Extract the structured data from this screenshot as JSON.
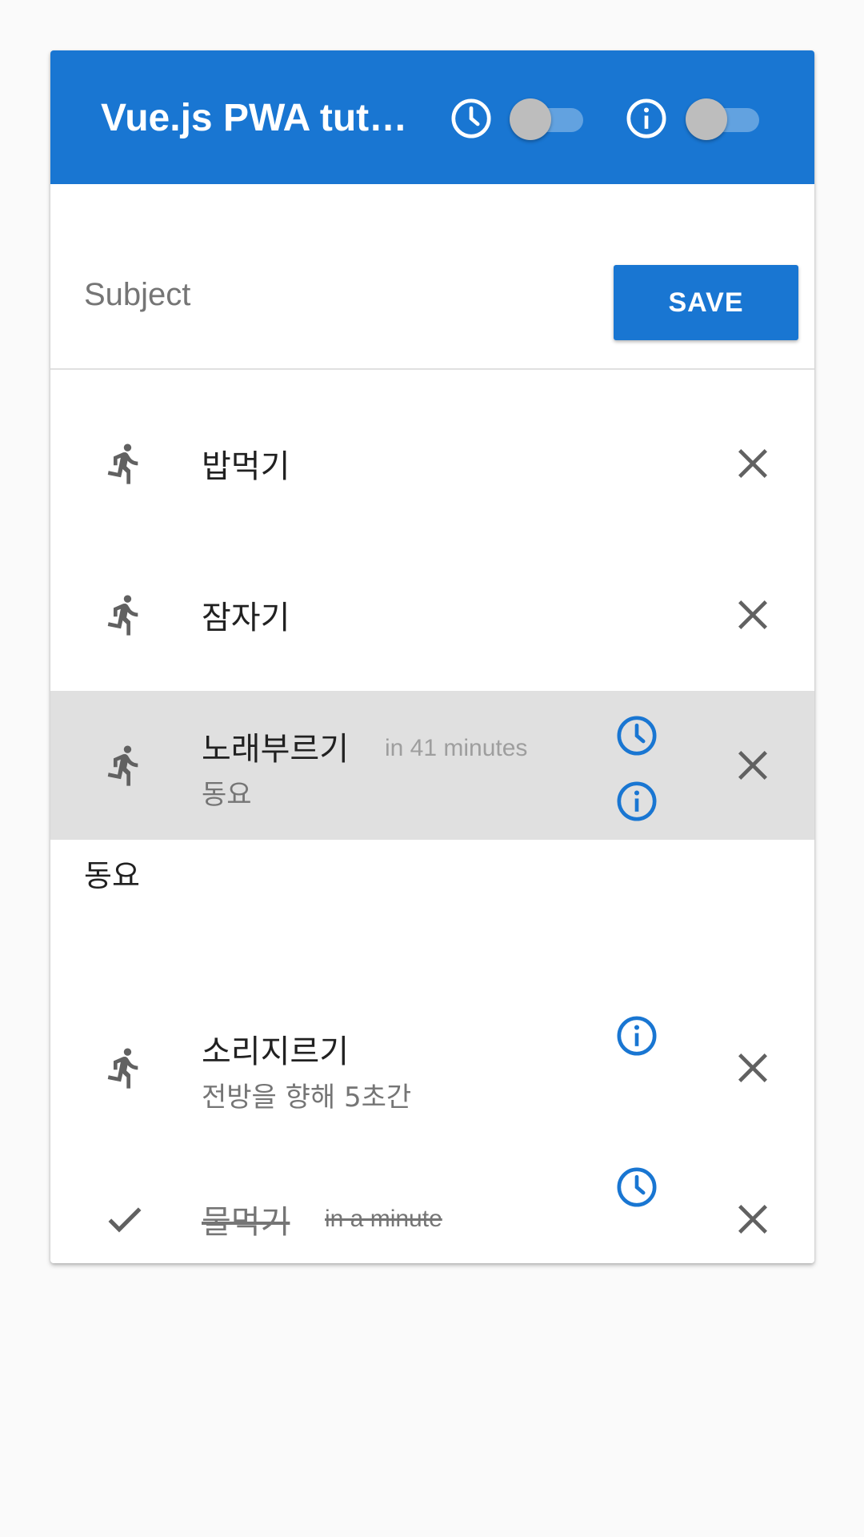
{
  "toolbar": {
    "title": "Vue.js PWA tutorial",
    "time_toggle": {
      "icon": "clock-icon",
      "on": false
    },
    "info_toggle": {
      "icon": "info-icon",
      "on": false
    },
    "color": "#1976d2"
  },
  "form": {
    "subject_placeholder": "Subject",
    "subject_value": "",
    "save_label": "SAVE"
  },
  "items": [
    {
      "icon": "running-icon",
      "title": "밥먹기",
      "time": "",
      "subtitle": "",
      "done": false,
      "show_clock": false,
      "show_info": false
    },
    {
      "icon": "running-icon",
      "title": "잠자기",
      "time": "",
      "subtitle": "",
      "done": false,
      "show_clock": false,
      "show_info": false
    },
    {
      "icon": "running-icon",
      "title": "노래부르기",
      "time": "in 41 minutes",
      "subtitle": "동요",
      "done": false,
      "show_clock": true,
      "show_info": true,
      "highlighted": true
    }
  ],
  "subheader": "동요",
  "items2": [
    {
      "icon": "running-icon",
      "title": "소리지르기",
      "time": "",
      "subtitle": "전방을 향해 5초간",
      "done": false,
      "show_clock": false,
      "show_info": true
    },
    {
      "icon": "check-icon",
      "title": "물먹기",
      "time": "in a minute",
      "subtitle": "",
      "done": true,
      "show_clock": true,
      "show_info": false
    }
  ]
}
